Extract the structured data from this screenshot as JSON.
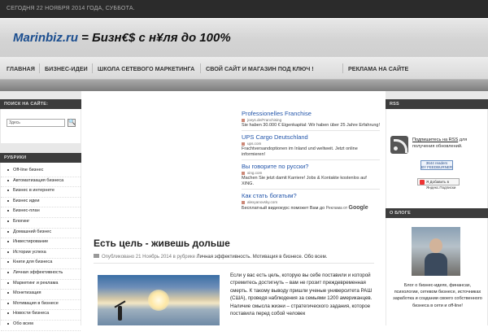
{
  "topbar": {
    "date": "СЕГОДНЯ 22 НОЯБРЯ 2014 ГОДА, СУББОТА."
  },
  "logo": {
    "site": "Marinbiz.ru",
    "slogan": " = Бизн€$ с н¥ля до 100%"
  },
  "nav": {
    "items": [
      "ГЛАВНАЯ",
      "БИЗНЕС-ИДЕИ",
      "ШКОЛА СЕТЕВОГО МАРКЕТИНГА",
      "СВОЙ САЙТ И МАГАЗИН ПОД КЛЮЧ !",
      "РЕКЛАМА НА САЙТЕ"
    ]
  },
  "left": {
    "search_title": "ПОИСК НА САЙТЕ:",
    "search_placeholder": "Здесь",
    "search_button": "🔍",
    "rubrics_title": "РУБРИКИ",
    "rubrics": [
      "Off-line бизнес",
      "Автоматизация бизнеса",
      "Бизнес в интернете",
      "Бизнес идеи",
      "Бизнес-план",
      "Блогинг",
      "Домашний бизнес",
      "Инвестирование",
      "Истории успеха",
      "Книги для бизнеса",
      "Личная эффективность",
      "Маркетинг и реклама",
      "Монетизация",
      "Мотивация в бизнесе",
      "Новости бизнеса",
      "Обо всем"
    ]
  },
  "ads": [
    {
      "title": "Professionelles Franchise",
      "url": "joeys.de/Franchising",
      "desc": "Sie haben 30.000 € Eigenkapital: Wir haben über 25 Jahre Erfahrung!"
    },
    {
      "title": "UPS Cargo Deutschland",
      "url": "ups.com",
      "desc": "Frachtversandoptionen im Inland und weltweit. Jetzt online informieren!"
    },
    {
      "title": "Вы говорите по русски?",
      "url": "xing.com",
      "desc": "Machen Sie jetzt damit Karriere! Jobs & Kontakte kostenlos auf XING."
    },
    {
      "title": "Как стать богатым?",
      "url": "alexyanovsky.com",
      "desc": "Бесплатный видеокурс поможет Вам до"
    }
  ],
  "ads_footer": {
    "label": "Реклама от",
    "brand": "Google"
  },
  "post": {
    "title": "Есть цель - живешь дольше",
    "meta_prefix": "Опубликовано 21 Ноябрь 2014 в рубрике ",
    "meta_cats": "Личная эффективность. Мотивация в бизнесе. Обо всем.",
    "text": "Если у вас есть цель, которую вы себе поставили и которой стремитесь достигнуть – вам не грозит преждевременная смерть. К такому выводу пришли ученые университета РАШ (США), проведя наблюдения за семьями 1200 американцев. Наличие смысла жизни – стратегического задания, которое поставила перед собой человек"
  },
  "right": {
    "rss_title": "RSS",
    "subscribe_link": "Подпишитесь на RSS",
    "subscribe_rest": " для получения обновлений.",
    "feedburner": "3644 readers\nBY FEEDBURNER",
    "yandex": "Я Добавить в Яндекс.Подписки",
    "about_title": "О БЛОГЕ",
    "about_text": "Блог о бизнес-идеях, финансах, психологии, сетевом бизнесе, источниках заработка и создании своего собственного бизнеса в сети и off-line!"
  }
}
